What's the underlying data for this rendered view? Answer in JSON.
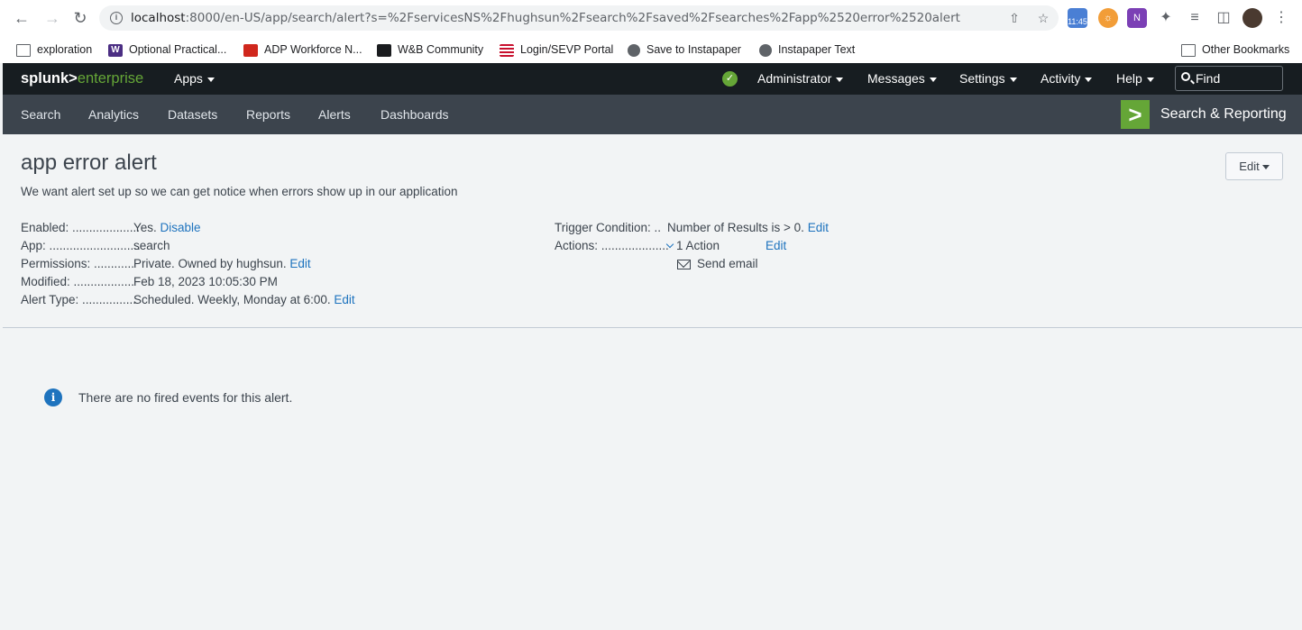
{
  "browser": {
    "url_host": "localhost",
    "url_path": ":8000/en-US/app/search/alert?s=%2FservicesNS%2Fhughsun%2Fsearch%2Fsaved%2Fsearches%2Fapp%2520error%2520alert",
    "calendar_time": "11:45",
    "bookmarks": [
      {
        "label": "exploration",
        "icon": "folder-icon"
      },
      {
        "label": "Optional Practical...",
        "icon": "uw-w-icon"
      },
      {
        "label": "ADP Workforce N...",
        "icon": "adp-icon"
      },
      {
        "label": "W&B Community",
        "icon": "wandb-icon"
      },
      {
        "label": "Login/SEVP Portal",
        "icon": "us-flag-icon"
      },
      {
        "label": "Save to Instapaper",
        "icon": "globe-icon"
      },
      {
        "label": "Instapaper Text",
        "icon": "globe-icon"
      }
    ],
    "other_bookmarks": "Other Bookmarks"
  },
  "splunk": {
    "logo_left": "splunk>",
    "logo_right": "enterprise",
    "apps_menu": "Apps",
    "top_menus": {
      "administrator": "Administrator",
      "messages": "Messages",
      "settings": "Settings",
      "activity": "Activity",
      "help": "Help"
    },
    "find_placeholder": "Find",
    "app_nav": [
      "Search",
      "Analytics",
      "Datasets",
      "Reports",
      "Alerts",
      "Dashboards"
    ],
    "app_title": "Search & Reporting",
    "colors": {
      "brand_green": "#65a637",
      "link_blue": "#1e73be",
      "header_dark": "#171d21",
      "appbar": "#3c444d"
    }
  },
  "alert": {
    "title": "app error alert",
    "description": "We want alert set up so we can get notice when errors show up in our application",
    "edit_button": "Edit",
    "details_left": {
      "enabled_label": "Enabled: ....................",
      "enabled_value": "Yes.",
      "enabled_link": "Disable",
      "app_label": "App: ...........................",
      "app_value": "search",
      "permissions_label": "Permissions: ............",
      "permissions_value": "Private. Owned by hughsun.",
      "permissions_link": "Edit",
      "modified_label": "Modified: ..................",
      "modified_value": "Feb 18, 2023 10:05:30 PM",
      "alert_type_label": "Alert Type: ................",
      "alert_type_value": "Scheduled. Weekly, Monday at 6:00.",
      "alert_type_link": "Edit"
    },
    "details_right": {
      "trigger_label": "Trigger Condition: ..",
      "trigger_value": "Number of Results is > 0.",
      "trigger_link": "Edit",
      "actions_label": "Actions: ....................",
      "actions_value": "1 Action",
      "actions_link": "Edit",
      "action_item": "Send email"
    },
    "empty_message": "There are no fired events for this alert."
  }
}
